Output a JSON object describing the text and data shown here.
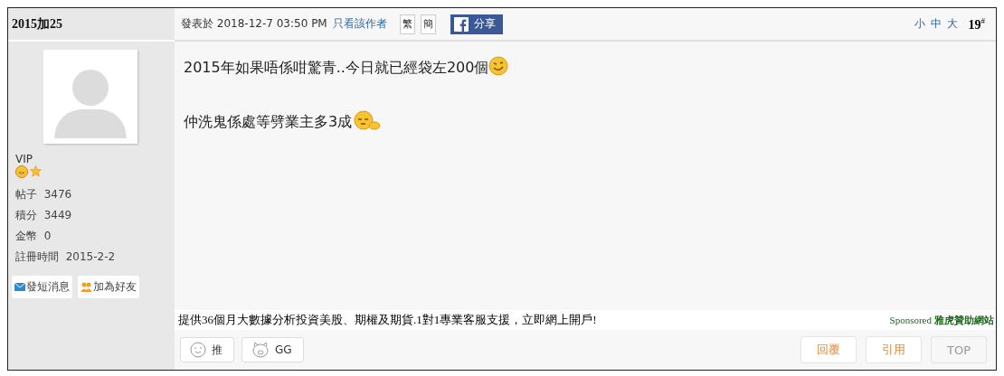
{
  "author": {
    "name": "2015加25",
    "rank": "VIP",
    "stats": [
      {
        "label": "帖子",
        "value": "3476"
      },
      {
        "label": "積分",
        "value": "3449"
      },
      {
        "label": "金幣",
        "value": "0"
      },
      {
        "label": "註冊時間",
        "value": "2015-2-2"
      }
    ],
    "actions": [
      {
        "kind": "message",
        "label": "發短消息"
      },
      {
        "kind": "friend",
        "label": "加為好友"
      }
    ]
  },
  "post": {
    "posted": "發表於 2018-12-7 03:50 PM",
    "author_only_link": "只看該作者",
    "script_buttons": [
      "繁",
      "簡"
    ],
    "share": "分享",
    "font_sizes": [
      "小",
      "中",
      "大"
    ],
    "floor": "19$^{#}$",
    "paragraphs": [
      {
        "text": "2015年如果唔係咁驚青..今日就已經袋左200個",
        "kind": "grin"
      },
      {
        "text": "仲洗鬼係處等劈業主多3成",
        "kind": "sleepy"
      }
    ],
    "ad": {
      "text": "提供36個月大數據分析投資美股、期權及期貨.1對1專業客服支援，立即網上開戶!",
      "sponsored": "Sponsored",
      "sponsor": "雅虎贊助網站"
    },
    "reactions": [
      {
        "kind": "like",
        "label": "推"
      },
      {
        "kind": "pig",
        "label": "GG"
      }
    ],
    "buttons": [
      {
        "kind": "reply",
        "label": "回覆"
      },
      {
        "kind": "quote",
        "label": "引用"
      },
      {
        "kind": "top",
        "label": "TOP"
      }
    ]
  }
}
